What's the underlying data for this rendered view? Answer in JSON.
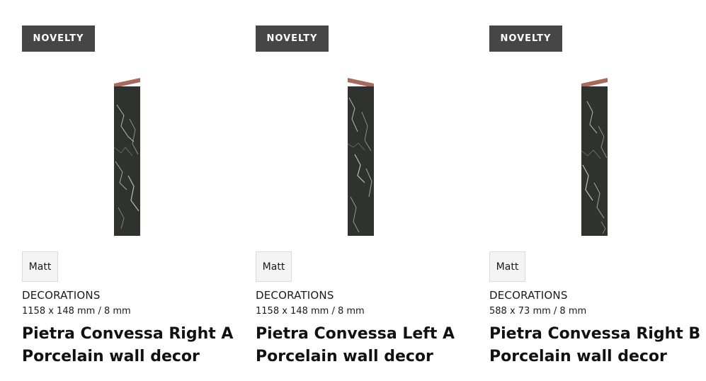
{
  "products": [
    {
      "badge": "NOVELTY",
      "finish": "Matt",
      "category": "DECORATIONS",
      "dimensions": "1158 x 148 mm / 8 mm",
      "title": "Pietra Convessa Right A Porcelain wall decor",
      "image_icon": "marble-strip-image"
    },
    {
      "badge": "NOVELTY",
      "finish": "Matt",
      "category": "DECORATIONS",
      "dimensions": "1158 x 148 mm / 8 mm",
      "title": "Pietra Convessa Left A Porcelain wall decor",
      "image_icon": "marble-strip-image"
    },
    {
      "badge": "NOVELTY",
      "finish": "Matt",
      "category": "DECORATIONS",
      "dimensions": "588 x 73 mm / 8 mm",
      "title": "Pietra Convessa Right B Porcelain wall decor",
      "image_icon": "marble-strip-image"
    }
  ],
  "colors": {
    "badge_bg": "#464646",
    "badge_text": "#ffffff",
    "marble_dark": "#2a2d2a",
    "marble_vein": "#d9d9d6",
    "copper_edge": "#a9695a",
    "chip_bg": "#f4f4f4",
    "chip_border": "#dadada"
  }
}
